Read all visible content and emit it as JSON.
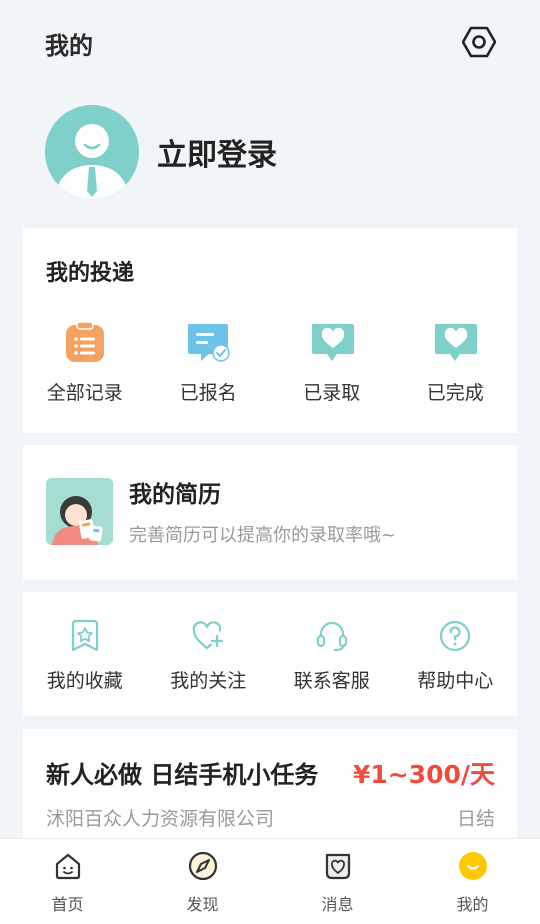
{
  "header": {
    "title": "我的"
  },
  "profile": {
    "login_label": "立即登录"
  },
  "delivery": {
    "title": "我的投递",
    "items": [
      {
        "label": "全部记录",
        "icon": "clipboard-icon",
        "color": "#f4a261"
      },
      {
        "label": "已报名",
        "icon": "chat-check-icon",
        "color": "#6ec4e8"
      },
      {
        "label": "已录取",
        "icon": "heart-chat-icon",
        "color": "#7fcfcb"
      },
      {
        "label": "已完成",
        "icon": "heart-chat-icon",
        "color": "#7fcfcb"
      }
    ]
  },
  "resume": {
    "title": "我的简历",
    "subtitle": "完善简历可以提高你的录取率哦~"
  },
  "tools": {
    "items": [
      {
        "label": "我的收藏",
        "icon": "star-bookmark-icon"
      },
      {
        "label": "我的关注",
        "icon": "heart-plus-icon"
      },
      {
        "label": "联系客服",
        "icon": "headset-icon"
      },
      {
        "label": "帮助中心",
        "icon": "question-icon"
      }
    ]
  },
  "job": {
    "title": "新人必做 日结手机小任务",
    "salary": "¥1~300/天",
    "company": "沭阳百众人力资源有限公司",
    "pay_type": "日结"
  },
  "tabbar": {
    "items": [
      {
        "label": "首页",
        "icon": "home-icon"
      },
      {
        "label": "发现",
        "icon": "compass-icon"
      },
      {
        "label": "消息",
        "icon": "message-icon"
      },
      {
        "label": "我的",
        "icon": "profile-smile-icon",
        "active": true
      }
    ]
  },
  "colors": {
    "accent": "#7fcfcb",
    "price": "#f04b3c",
    "tab_active": "#ffc900"
  }
}
